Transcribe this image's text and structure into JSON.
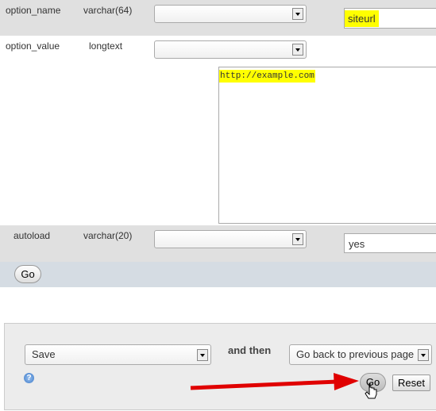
{
  "rows": [
    {
      "name": "option_name",
      "type": "varchar(64)",
      "value": "siteurl"
    },
    {
      "name": "option_value",
      "type": "longtext",
      "value": "http://example.com"
    },
    {
      "name": "autoload",
      "type": "varchar(20)",
      "value": "yes"
    }
  ],
  "go_label": "Go",
  "footer": {
    "action": "Save",
    "and_then": "and then",
    "after": "Go back to previous page",
    "go": "Go",
    "reset": "Reset"
  },
  "colors": {
    "highlight": "#ffff00",
    "arrow": "#e00000",
    "row_bg": "#e0e0e0",
    "go_bar": "#d5dce3"
  }
}
